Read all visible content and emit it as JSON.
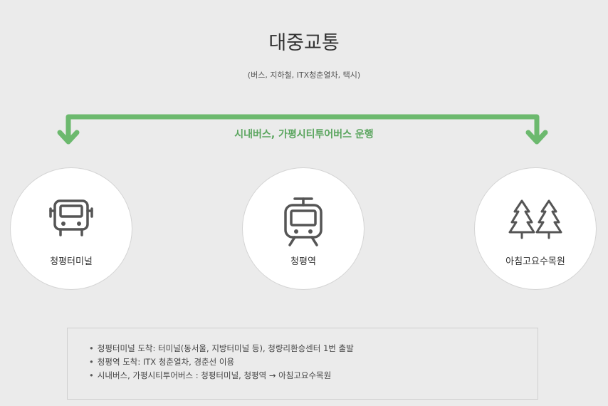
{
  "header": {
    "title": "대중교통",
    "subtitle": "(버스, 지하철, ITX청춘열차, 택시)"
  },
  "route": {
    "label": "시내버스, 가평시티투어버스 운행",
    "color": "#6cb96e"
  },
  "stops": [
    {
      "label": "청평터미널",
      "icon": "bus-icon"
    },
    {
      "label": "청평역",
      "icon": "train-icon"
    },
    {
      "label": "아침고요수목원",
      "icon": "trees-icon"
    }
  ],
  "info": {
    "items": [
      "청평터미널 도착: 터미널(동서울, 지방터미널 등), 청량리환승센터 1번 출발",
      "청평역 도착: ITX 청춘열차, 경춘선 이용",
      "시내버스, 가평시티투어버스 : 청평터미널, 청평역 → 아침고요수목원"
    ]
  }
}
